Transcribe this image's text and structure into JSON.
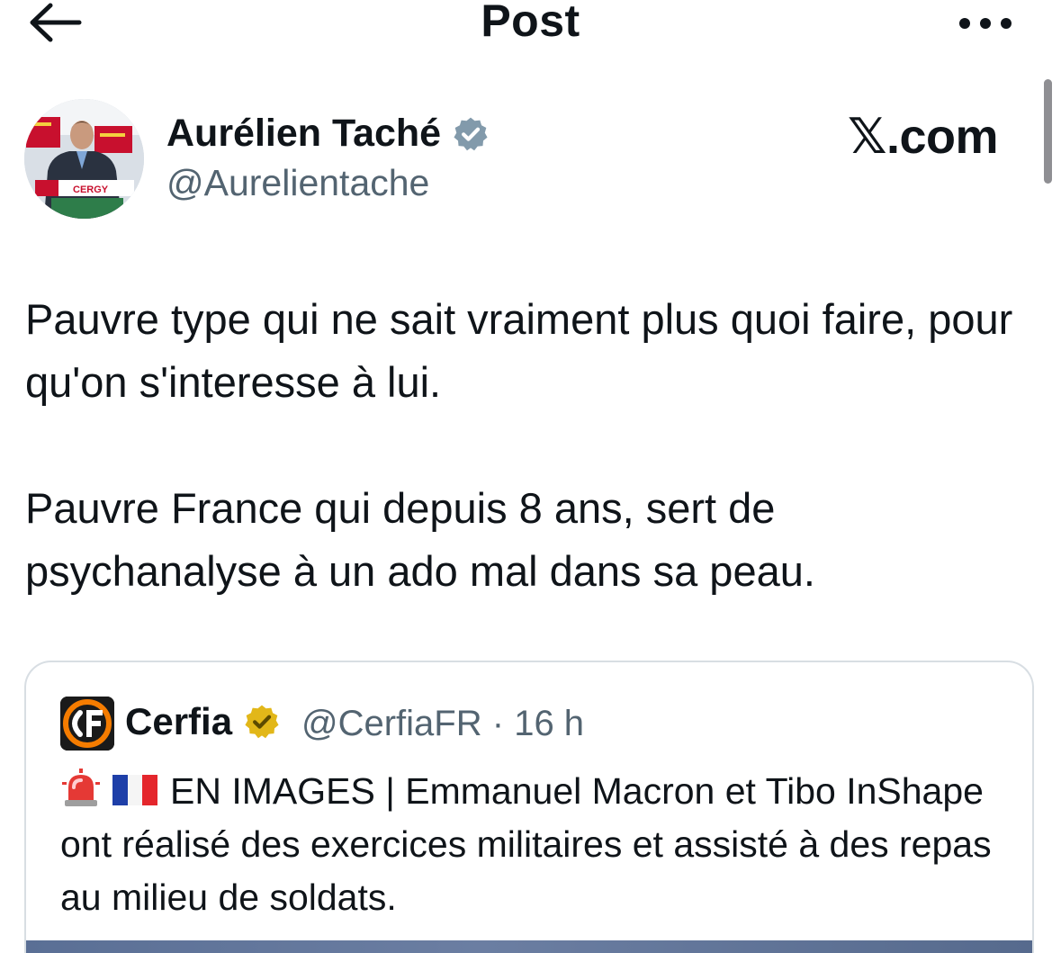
{
  "header": {
    "title": "Post"
  },
  "author": {
    "name": "Aurélien Taché",
    "handle": "@Aurelientache",
    "verified_color": "#829aab"
  },
  "watermark": "𝕏.com",
  "post": {
    "paragraphs": [
      "Pauvre type qui ne sait vraiment plus quoi faire, pour qu'on s'interesse à lui.",
      "Pauvre France qui depuis 8 ans, sert de psychanalyse à un ado mal dans sa peau."
    ]
  },
  "quote": {
    "name": "Cerfia",
    "handle": "@CerfiaFR",
    "separator": "·",
    "time": "16 h",
    "verified_color": "#e2b719",
    "text": "EN IMAGES | Emmanuel Macron et Tibo InShape ont réalisé des exercices militaires et assisté à des repas au milieu de soldats.",
    "emojis": [
      "rotating-light-emoji",
      "france-flag-emoji"
    ]
  },
  "colors": {
    "text": "#0f1419",
    "secondary": "#536471",
    "border": "#d8dee3"
  }
}
